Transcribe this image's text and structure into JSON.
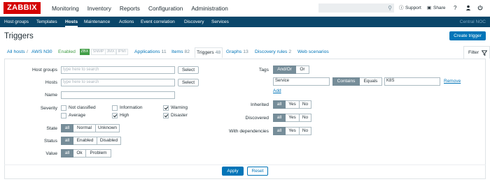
{
  "app": {
    "logo": "ZABBIX"
  },
  "main_menu": [
    "Monitoring",
    "Inventory",
    "Reports",
    "Configuration",
    "Administration"
  ],
  "top_right": {
    "support": "Support",
    "share": "Share",
    "help": "?"
  },
  "sub_menu": [
    "Host groups",
    "Templates",
    "Hosts",
    "Maintenance",
    "Actions",
    "Event correlation",
    "Discovery",
    "Services"
  ],
  "sub_menu_right": "Central NOC",
  "page": {
    "title": "Triggers",
    "create_button": "Create trigger"
  },
  "breadcrumbs": {
    "all_hosts": "All hosts",
    "sep": "/",
    "host": "AWS N30",
    "status": "Enabled",
    "zbx": "ZBX",
    "snmp": "SNMP",
    "jmx": "JMX",
    "ipmi": "IPMI",
    "tabs": [
      {
        "label": "Applications",
        "count": "11"
      },
      {
        "label": "Items",
        "count": "82"
      },
      {
        "label": "Triggers",
        "count": "48"
      },
      {
        "label": "Graphs",
        "count": "13"
      },
      {
        "label": "Discovery rules",
        "count": "2"
      },
      {
        "label": "Web scenarios",
        "count": ""
      }
    ]
  },
  "filter": {
    "tab_label": "Filter",
    "host_groups": {
      "label": "Host groups",
      "placeholder": "type here to search",
      "button": "Select"
    },
    "hosts": {
      "label": "Hosts",
      "placeholder": "type here to search",
      "button": "Select"
    },
    "name": {
      "label": "Name",
      "value": ""
    },
    "severity": {
      "label": "Severity",
      "options": [
        {
          "label": "Not classified",
          "checked": false
        },
        {
          "label": "Information",
          "checked": false
        },
        {
          "label": "Warning",
          "checked": true
        },
        {
          "label": "Average",
          "checked": false
        },
        {
          "label": "High",
          "checked": true
        },
        {
          "label": "Disaster",
          "checked": true
        }
      ]
    },
    "state": {
      "label": "State",
      "options": [
        "all",
        "Normal",
        "Unknown"
      ],
      "selected": "all"
    },
    "status": {
      "label": "Status",
      "options": [
        "all",
        "Enabled",
        "Disabled"
      ],
      "selected": "all"
    },
    "value": {
      "label": "Value",
      "options": [
        "all",
        "Ok",
        "Problem"
      ],
      "selected": "all"
    },
    "tags": {
      "label": "Tags",
      "modes": [
        "And/Or",
        "Or"
      ],
      "selected_mode": "And/Or",
      "row": {
        "tag": "Service",
        "operators": [
          "Contains",
          "Equals"
        ],
        "selected_operator": "Contains",
        "value": "K8S",
        "remove": "Remove"
      },
      "add": "Add"
    },
    "inherited": {
      "label": "Inherited",
      "options": [
        "all",
        "Yes",
        "No"
      ],
      "selected": "all"
    },
    "discovered": {
      "label": "Discovered",
      "options": [
        "all",
        "Yes",
        "No"
      ],
      "selected": "all"
    },
    "with_dependencies": {
      "label": "With dependencies",
      "options": [
        "all",
        "Yes",
        "No"
      ],
      "selected": "all"
    },
    "apply": "Apply",
    "reset": "Reset"
  },
  "colors": {
    "accent": "#0275b8",
    "nav_bg": "#0a466a",
    "logo": "#d40000",
    "selected_segment": "#768d99",
    "enabled": "#429e47"
  }
}
